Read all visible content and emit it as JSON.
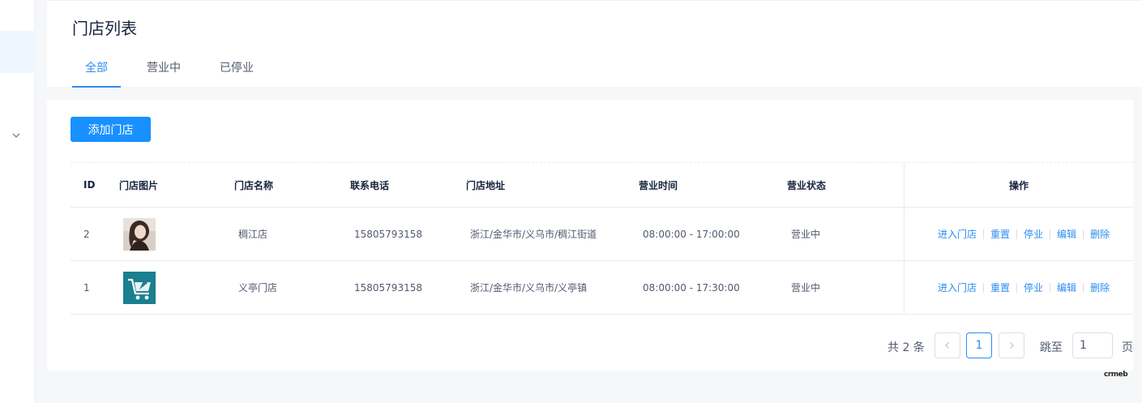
{
  "header": {
    "title": "门店列表"
  },
  "tabs": [
    {
      "label": "全部",
      "active": true
    },
    {
      "label": "营业中",
      "active": false
    },
    {
      "label": "已停业",
      "active": false
    }
  ],
  "toolbar": {
    "add_label": "添加门店"
  },
  "table": {
    "columns": [
      "ID",
      "门店图片",
      "门店名称",
      "联系电话",
      "门店地址",
      "营业时间",
      "营业状态",
      "操作"
    ],
    "rows": [
      {
        "id": "2",
        "image_icon": "portrait-photo",
        "name": "稠江店",
        "phone": "15805793158",
        "address": "浙江/金华市/义乌市/稠江街道",
        "hours": "08:00:00 - 17:00:00",
        "status": "营业中"
      },
      {
        "id": "1",
        "image_icon": "shopping-cart-logo",
        "name": "义亭门店",
        "phone": "15805793158",
        "address": "浙江/金华市/义乌市/义亭镇",
        "hours": "08:00:00 - 17:30:00",
        "status": "营业中"
      }
    ],
    "actions": [
      "进入门店",
      "重置",
      "停业",
      "编辑",
      "删除"
    ]
  },
  "pagination": {
    "total_text": "共 2 条",
    "current_page": "1",
    "jump_label": "跳至",
    "jump_value": "1",
    "page_label": "页"
  },
  "brand": {
    "logo_text": "crmeb"
  },
  "colors": {
    "primary": "#2d8cf0",
    "button": "#1890ff",
    "text": "#515a6e",
    "heading": "#17233d"
  }
}
